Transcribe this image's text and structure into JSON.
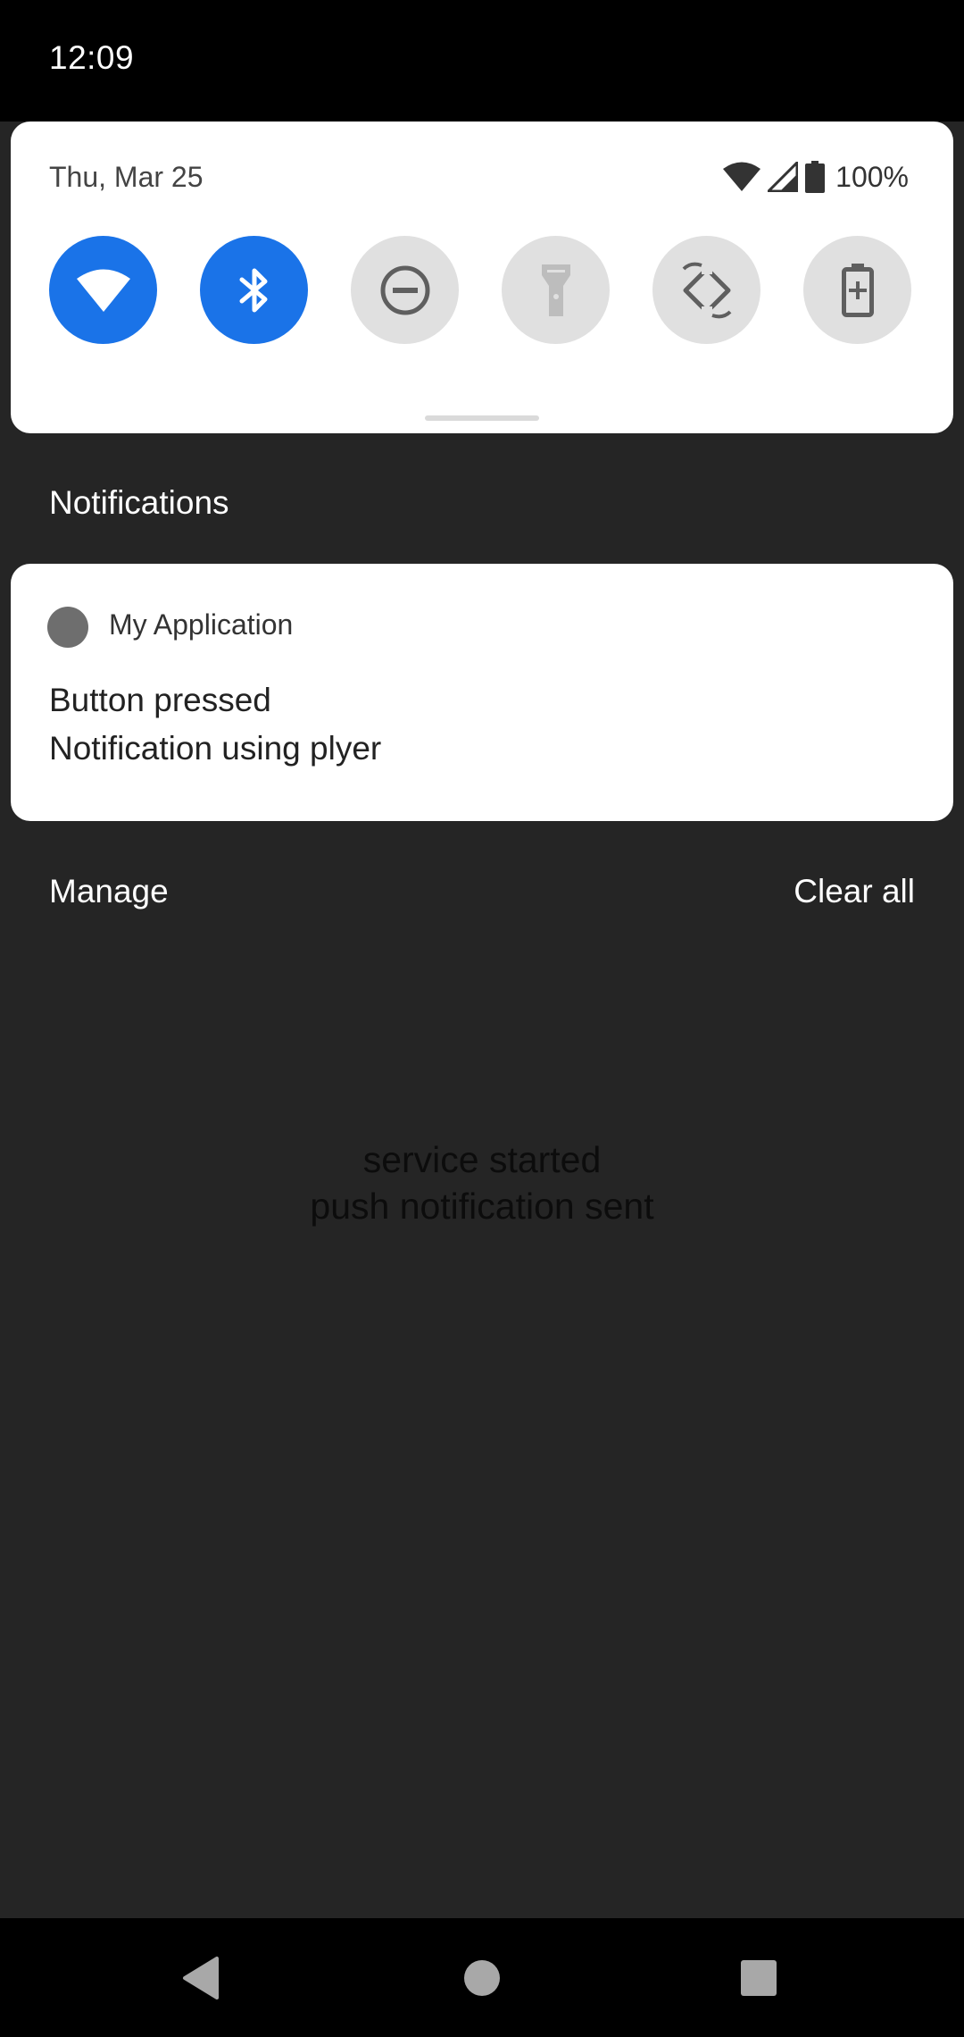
{
  "status_bar": {
    "time": "12:09"
  },
  "quick_settings": {
    "date": "Thu, Mar 25",
    "battery_percent": "100%",
    "tiles": [
      {
        "name": "wifi",
        "icon": "wifi-icon",
        "state": "on"
      },
      {
        "name": "bluetooth",
        "icon": "bluetooth-icon",
        "state": "on"
      },
      {
        "name": "do-not-disturb",
        "icon": "do-not-disturb-icon",
        "state": "off"
      },
      {
        "name": "flashlight",
        "icon": "flashlight-icon",
        "state": "off"
      },
      {
        "name": "auto-rotate",
        "icon": "auto-rotate-icon",
        "state": "off"
      },
      {
        "name": "battery-saver",
        "icon": "battery-saver-icon",
        "state": "off"
      }
    ]
  },
  "notifications": {
    "section_title": "Notifications",
    "items": [
      {
        "app_name": "My Application",
        "title": "Button pressed",
        "text": "Notification using plyer"
      }
    ],
    "manage_label": "Manage",
    "clear_all_label": "Clear all"
  },
  "app_content": {
    "line1": "service started",
    "line2": "push notification sent"
  },
  "colors": {
    "accent": "#1a73e8",
    "tile_off": "#e0e0e0",
    "shade_background": "#252525",
    "card_background": "#ffffff"
  }
}
